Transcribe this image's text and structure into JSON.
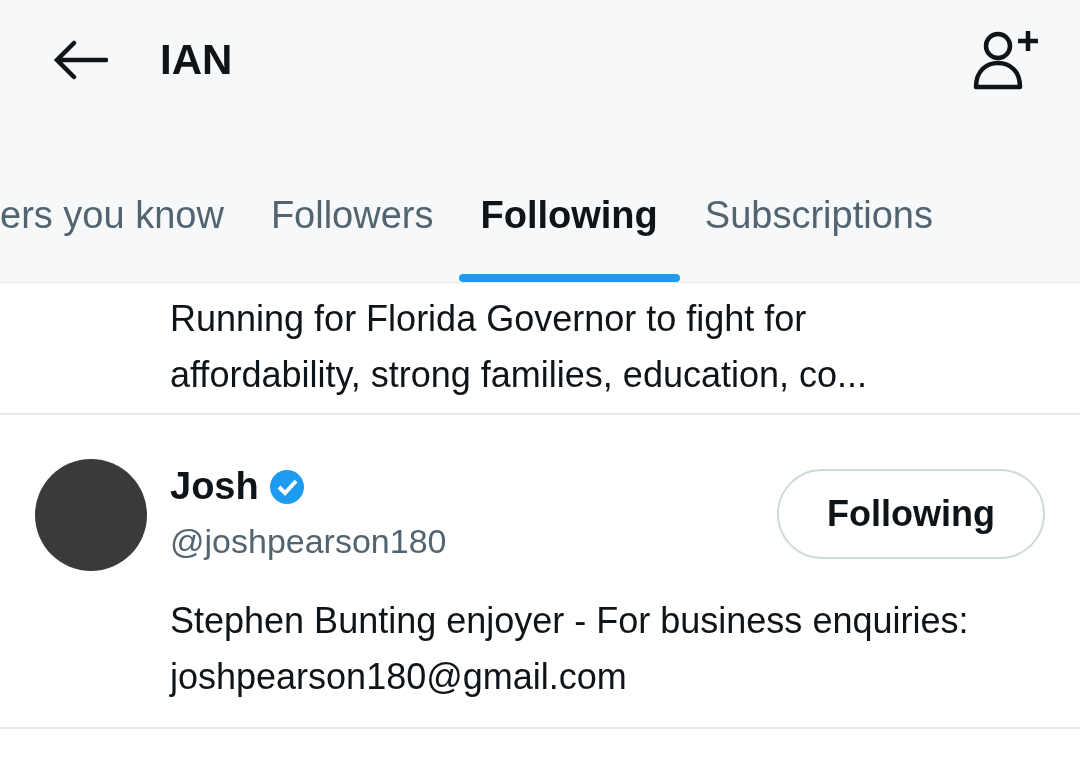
{
  "header": {
    "title": "IAN"
  },
  "tabs": [
    {
      "label": "ers you know",
      "selected": false
    },
    {
      "label": "Followers",
      "selected": false
    },
    {
      "label": "Following",
      "selected": true
    },
    {
      "label": "Subscriptions",
      "selected": false
    }
  ],
  "users": [
    {
      "kind": "bio_only",
      "bio": "Running for Florida Governor to fight for affordability, strong families, education, co..."
    },
    {
      "kind": "full",
      "name": "Josh",
      "verified": true,
      "handle": "@joshpearson180",
      "button": "Following",
      "bio": "Stephen Bunting enjoyer - For business enquiries: joshpearson180@gmail.com"
    }
  ]
}
